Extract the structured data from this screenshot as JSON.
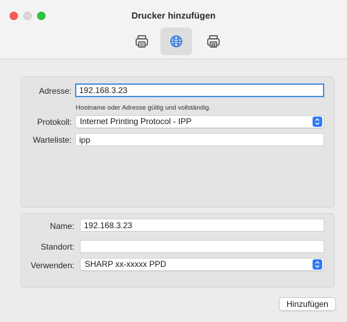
{
  "window": {
    "title": "Drucker hinzufügen",
    "traffic_lights": [
      "close",
      "minimize",
      "zoom"
    ]
  },
  "toolbar": {
    "items": [
      {
        "icon": "printer-icon",
        "name": "Standard"
      },
      {
        "icon": "globe-icon",
        "name": "IP",
        "selected": true
      },
      {
        "icon": "windows-printer-icon",
        "name": "Windows"
      }
    ]
  },
  "form": {
    "address_label": "Adresse:",
    "address_value": "192.168.3.23",
    "address_hint": "Hostname oder Adresse gültig und vollständig.",
    "protocol_label": "Protokoll:",
    "protocol_value": "Internet Printing Protocol - IPP",
    "queue_label": "Warteliste:",
    "queue_value": "ipp",
    "name_label": "Name:",
    "name_value": "192.168.3.23",
    "location_label": "Standort:",
    "location_value": "",
    "use_label": "Verwenden:",
    "use_value": "SHARP xx-xxxxx PPD"
  },
  "actions": {
    "add_label": "Hinzufügen"
  },
  "colors": {
    "accent": "#2f7bf5",
    "focus_ring": "#4a90e2",
    "close": "#ff5f57",
    "zoom": "#28c840"
  }
}
